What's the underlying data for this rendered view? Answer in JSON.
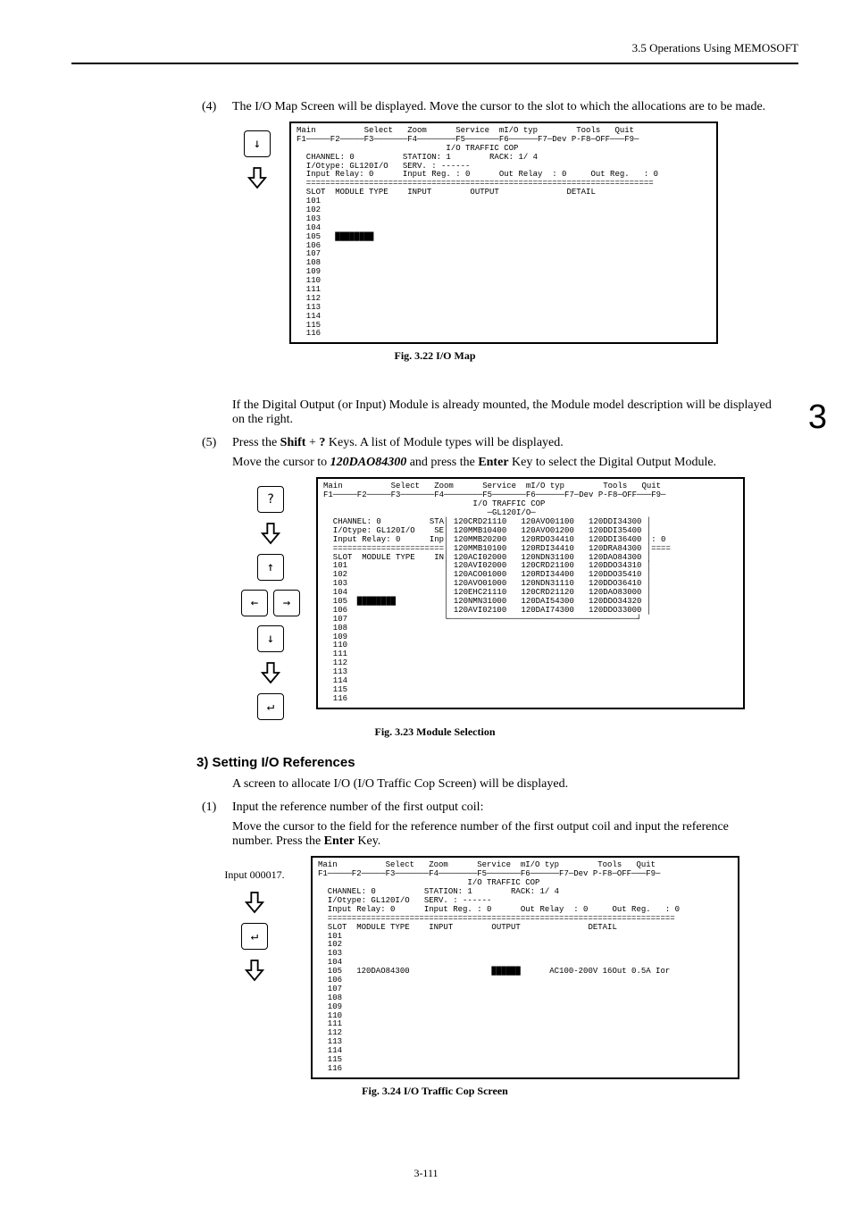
{
  "header": {
    "section": "3.5 Operations Using MEMOSOFT"
  },
  "chapter_number": "3",
  "step4": {
    "num": "(4)",
    "text": "The I/O Map Screen will be displayed.  Move the cursor to the slot to which the allocations are to be made."
  },
  "fig322": {
    "caption": "Fig. 3.22  I/O Map",
    "menu": "Main          Select   Zoom      Service  mI/O typ        Tools   Quit",
    "fkeys": "F1─────F2─────F3───────F4────────F5───────F6──────F7─Dev P-F8─OFF───F9─",
    "line_traffic": "                               I/O TRAFFIC COP",
    "line_chan": "  CHANNEL: 0          STATION: 1        RACK: 1/ 4",
    "line_iotype": "  I/Otype: GL120I/O   SERV. : ------",
    "line_relay": "  Input Relay: 0      Input Reg. : 0      Out Relay  : 0     Out Reg.   : 0",
    "sep": "  ========================================================================",
    "line_hdr": "  SLOT  MODULE TYPE    INPUT        OUTPUT              DETAIL",
    "slots": [
      "101",
      "102",
      "103",
      "104",
      "105",
      "106",
      "107",
      "108",
      "109",
      "110",
      "111",
      "112",
      "113",
      "114",
      "115",
      "116"
    ]
  },
  "post322_text": "If the Digital Output (or Input) Module is already mounted, the Module model description will be displayed on the right.",
  "step5": {
    "num": "(5)",
    "text_a": "Press the ",
    "shift": "Shift",
    "plus": " + ",
    "qmark": "?",
    "text_b": " Keys.  A list of Module types will be displayed.",
    "text2a": "Move the cursor to ",
    "model": "120DAO84300",
    "text2b": " and press the ",
    "enter": "Enter",
    "text2c": " Key to select the Digital Output Module."
  },
  "fig323": {
    "caption": "Fig. 3.23  Module Selection",
    "menu": "Main          Select   Zoom      Service  mI/O typ        Tools   Quit",
    "fkeys": "F1─────F2─────F3───────F4────────F5───────F6──────F7─Dev P-F8─OFF───F9─",
    "line_traffic": "                               I/O TRAFFIC COP",
    "line_sub": "                                  ─GL120I/O─",
    "line_chan": "  CHANNEL: 0          STA│ 120CRD21110   120AVO01100   120DDI34300 │",
    "line_iotype": "  I/Otype: GL120I/O    SE│ 120MMB10400   120AVO01200   120DDI35400 │",
    "line_relay": "  Input Relay: 0      Inp│ 120MMB20200   120RDO34410   120DDI36400 │: 0",
    "sep": "  =======================│ 120MMB10100   120RDI34410   120DRA84300 │====",
    "line_hdr": "  SLOT  MODULE TYPE    IN│ 120ACI02000   120NDN31100   120DAO84300 │",
    "row_101": "  101                    │ 120AVI02000   120CRD21100   120DDO34310 │",
    "row_102": "  102                    │ 120ACO01000   120RDI34400   120DDO35410 │",
    "row_103": "  103                    │ 120AVO01000   120NDN31110   120DDO36410 │",
    "row_104": "  104                    │ 120EHC21110   120CRD21120   120DAO83000 │",
    "row_105": "  105  ████████          │ 120NMN31000   120DAI54300   120DDO34320 │",
    "row_106": "  106                    │ 120AVI02100   120DAI74300   120DDO33000 │",
    "row_107": "  107                    └───────────────────────────────────────┘",
    "slots_rest": [
      "108",
      "109",
      "110",
      "111",
      "112",
      "113",
      "114",
      "115",
      "116"
    ]
  },
  "section3": {
    "heading": "3) Setting I/O References",
    "text": "A screen to allocate I/O (I/O Traffic Cop Screen) will be displayed."
  },
  "step1b": {
    "num": "(1)",
    "text": "Input the reference number of the first output coil:",
    "text2a": "Move the cursor to the field for the reference number of the first output coil and input the reference number.  Press the ",
    "enter": "Enter",
    "text2b": " Key."
  },
  "fig324": {
    "caption": "Fig. 3.24  I/O Traffic Cop Screen",
    "input_label": "Input 000017.",
    "menu": "Main          Select   Zoom      Service  mI/O typ        Tools   Quit",
    "fkeys": "F1─────F2─────F3───────F4────────F5───────F6──────F7─Dev P-F8─OFF───F9─",
    "line_traffic": "                               I/O TRAFFIC COP",
    "line_chan": "  CHANNEL: 0          STATION: 1        RACK: 1/ 4",
    "line_iotype": "  I/Otype: GL120I/O   SERV. : ------",
    "line_relay": "  Input Relay: 0      Input Reg. : 0      Out Relay  : 0     Out Reg.   : 0",
    "sep": "  ========================================================================",
    "line_hdr": "  SLOT  MODULE TYPE    INPUT        OUTPUT              DETAIL",
    "row_105": "  105   120DAO84300                 ██████      AC100-200V 16Out 0.5A Ior",
    "slots_a": [
      "101",
      "102",
      "103",
      "104"
    ],
    "slots_b": [
      "106",
      "107",
      "108",
      "109",
      "110",
      "111",
      "112",
      "113",
      "114",
      "115",
      "116"
    ]
  },
  "footer": "3-111"
}
